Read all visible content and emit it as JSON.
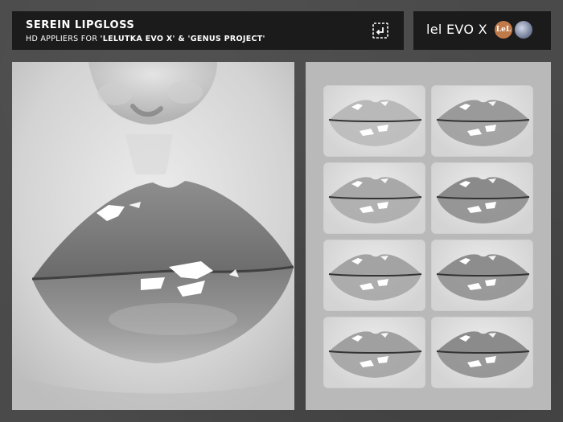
{
  "header": {
    "title": "SEREIN LIPGLOSS",
    "subtitle_prefix": "HD APPLIERS FOR ",
    "subtitle_bold": "'LELUTKA EVO X' & 'GENUS PROJECT'",
    "icon": "redeliver-icon"
  },
  "brand": {
    "text": "lel EVO X",
    "logo1_text": "LeL",
    "logo1_color": "#c07a4a",
    "logo2_name": "genus-logo"
  },
  "swatches": [
    {
      "name": "shade-1",
      "tone": "#b9b9b9"
    },
    {
      "name": "shade-2",
      "tone": "#9a9a9a"
    },
    {
      "name": "shade-3",
      "tone": "#a8a8a8"
    },
    {
      "name": "shade-4",
      "tone": "#8a8a8a"
    },
    {
      "name": "shade-5",
      "tone": "#a3a3a3"
    },
    {
      "name": "shade-6",
      "tone": "#8d8d8d"
    },
    {
      "name": "shade-7",
      "tone": "#a0a0a0"
    },
    {
      "name": "shade-8",
      "tone": "#8b8b8b"
    }
  ]
}
